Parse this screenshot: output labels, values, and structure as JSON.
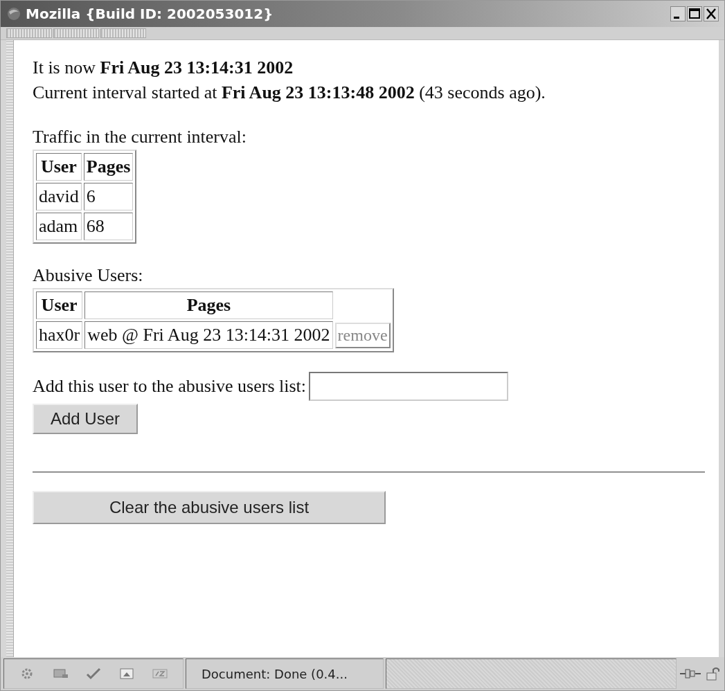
{
  "window": {
    "title": "Mozilla {Build ID: 2002053012}"
  },
  "status_lines": [
    "It is now **Fri Aug 23 13:14:31 2002**",
    "Current interval started at **Fri Aug 23 13:13:48 2002** (43 seconds ago)."
  ],
  "traffic": {
    "heading": "Traffic in the current interval:",
    "columns": [
      "User",
      "Pages"
    ],
    "rows": [
      {
        "user": "david",
        "pages": "6"
      },
      {
        "user": "adam",
        "pages": "68"
      }
    ]
  },
  "abusive": {
    "heading": "Abusive Users:",
    "columns": [
      "User",
      "Pages"
    ],
    "rows": [
      {
        "user": "hax0r",
        "pages": "web @ Fri Aug 23 13:14:31 2002",
        "action": "remove"
      }
    ]
  },
  "add_form": {
    "label": "Add this user to the abusive users list:",
    "button": "Add User"
  },
  "clear_button": "Clear the abusive users list",
  "status_bar": {
    "text": "Document: Done (0.4..."
  }
}
